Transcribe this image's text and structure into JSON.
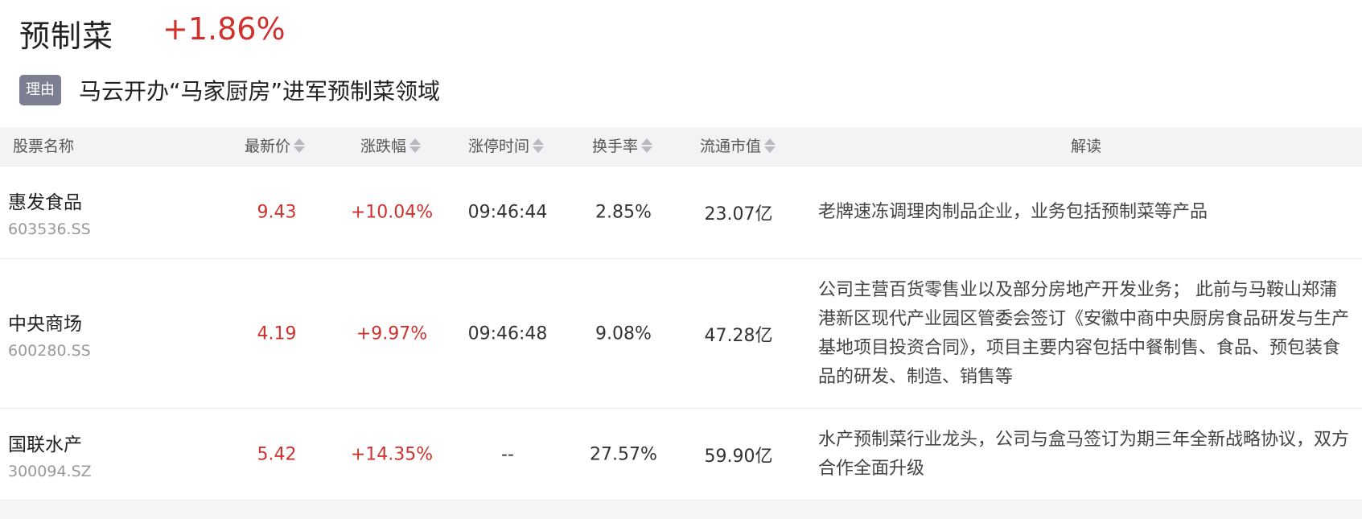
{
  "sector": {
    "name": "预制菜",
    "change": "+1.86%"
  },
  "reason": {
    "tag": "理由",
    "text": "马云开办“马家厨房”进军预制菜领域"
  },
  "table": {
    "headers": {
      "name": "股票名称",
      "price": "最新价",
      "change": "涨跌幅",
      "limit_time": "涨停时间",
      "turnover": "换手率",
      "float_cap": "流通市值",
      "interpretation": "解读"
    },
    "rows": [
      {
        "name": "惠发食品",
        "code": "603536.SS",
        "price": "9.43",
        "change": "+10.04%",
        "limit_time": "09:46:44",
        "turnover": "2.85%",
        "float_cap": "23.07亿",
        "interpretation": "老牌速冻调理肉制品企业，业务包括预制菜等产品"
      },
      {
        "name": "中央商场",
        "code": "600280.SS",
        "price": "4.19",
        "change": "+9.97%",
        "limit_time": "09:46:48",
        "turnover": "9.08%",
        "float_cap": "47.28亿",
        "interpretation": "公司主营百货零售业以及部分房地产开发业务； 此前与马鞍山郑蒲港新区现代产业园区管委会签订《安徽中商中央厨房食品研发与生产基地项目投资合同》，项目主要内容包括中餐制售、食品、预包装食品的研发、制造、销售等"
      },
      {
        "name": "国联水产",
        "code": "300094.SZ",
        "price": "5.42",
        "change": "+14.35%",
        "limit_time": "--",
        "turnover": "27.57%",
        "float_cap": "59.90亿",
        "interpretation": "水产预制菜行业龙头，公司与盒马签订为期三年全新战略协议，双方合作全面升级"
      }
    ]
  }
}
